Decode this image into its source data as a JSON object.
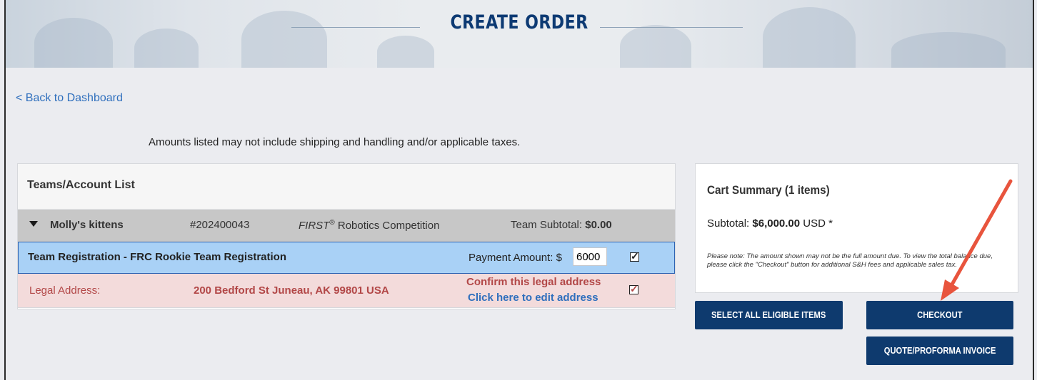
{
  "banner": {
    "title": "CREATE ORDER"
  },
  "nav": {
    "back_link": "< Back to Dashboard"
  },
  "notice": "Amounts listed may not include shipping and handling and/or applicable taxes.",
  "teams_panel": {
    "title": "Teams/Account List",
    "team": {
      "name": "Molly's kittens",
      "number": "#202400043",
      "program_prefix": "FIRST",
      "program_reg": "®",
      "program_suffix": " Robotics Competition",
      "subtotal_label": "Team Subtotal: ",
      "subtotal_value": "$0.00"
    },
    "registration": {
      "label": "Team Registration - FRC Rookie Team Registration",
      "payment_label": "Payment Amount: $",
      "payment_value": "6000",
      "checked": true
    },
    "address": {
      "label": "Legal Address:",
      "value": "200 Bedford St Juneau, AK 99801 USA",
      "confirm": "Confirm this legal address",
      "edit_link": "Click here to edit address",
      "checked": true
    }
  },
  "cart": {
    "title": "Cart Summary (1 items)",
    "subtotal_label": "Subtotal: ",
    "subtotal_value": "$6,000.00",
    "subtotal_currency": " USD *",
    "note": "Please note: The amount shown may not be the full amount due. To view the total balance due, please click the \"Checkout\" button for additional S&H fees and applicable sales tax."
  },
  "buttons": {
    "select_all": "SELECT ALL ELIGIBLE ITEMS",
    "checkout": "CHECKOUT",
    "quote": "QUOTE/PROFORMA INVOICE"
  },
  "colors": {
    "brand_navy": "#0e3a6e",
    "link_blue": "#2f6fbd",
    "highlight_blue": "#a9d1f6",
    "address_red": "#b24747",
    "arrow_red": "#e8543d"
  },
  "icons": {
    "arrow_annotation": "red-arrow-icon",
    "expand": "caret-down-icon",
    "check": "checkbox-checked-icon"
  }
}
